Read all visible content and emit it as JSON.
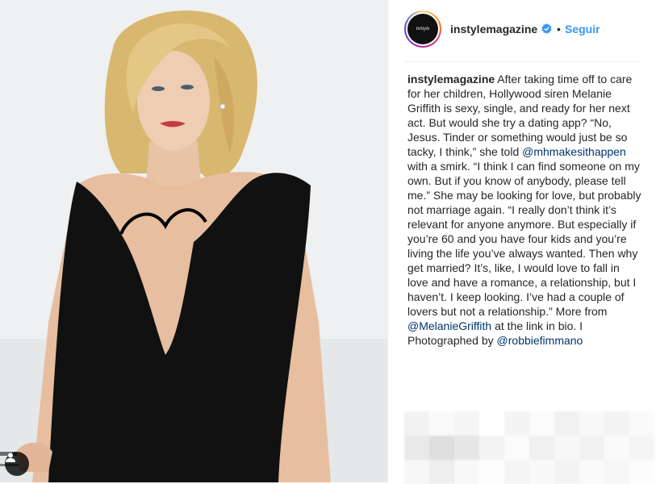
{
  "post": {
    "username": "instylemagazine",
    "avatar_text": "InStyle",
    "separator": "•",
    "follow_label": "Seguir",
    "caption": {
      "username": "instylemagazine",
      "part1": " After taking time off to care for her children, Hollywood siren Melanie Griffith is sexy, single, and ready for her next act. But would she try a dating app? “No, Jesus. Tinder or something would just be so tacky, I think,” she told ",
      "mention1": "@mhmakesithappen",
      "part2": " with a smirk. “I think I can find someone on my own. But if you know of anybody, please tell me.” She may be looking for love, but probably not marriage again. “I really don’t think it’s relevant for anyone anymore. But especially if you’re 60 and you have four kids and you’re living the life you’ve always wanted. Then why get married? It’s, like, I would love to fall in love and have a romance, a relationship, but I haven’t. I keep looking. I’ve had a couple of lovers but not a relationship.” More from ",
      "mention2": "@MelanieGriffith",
      "part3": " at the link in bio. I Photographed by ",
      "mention3": "@robbiefimmano"
    }
  },
  "icons": {
    "verified": "verified-badge-icon",
    "tag": "user-tag-icon"
  },
  "colors": {
    "link_blue": "#3897f0",
    "mention_blue": "#003569",
    "text": "#262626",
    "verified": "#3897f0"
  }
}
